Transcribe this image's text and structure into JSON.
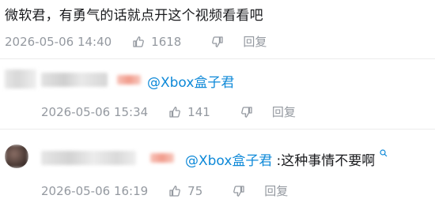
{
  "top_comment": {
    "text": "微软君，有勇气的话就点开这个视频看看吧",
    "timestamp": "2026-05-06 14:40",
    "likes": "1618",
    "reply_label": "回复"
  },
  "replies": [
    {
      "mention": "@Xbox盒子君",
      "text": "",
      "timestamp": "2026-05-06 15:34",
      "likes": "141",
      "reply_label": "回复"
    },
    {
      "mention": "@Xbox盒子君",
      "text": ":这种事情不要啊",
      "timestamp": "2026-05-06 16:19",
      "likes": "75",
      "reply_label": "回复"
    }
  ],
  "colors": {
    "mention": "#0e89d8",
    "meta_text": "#9499a0",
    "text": "#18191c"
  },
  "icons": [
    "thumbs-up-icon",
    "thumbs-down-icon",
    "search-icon"
  ]
}
